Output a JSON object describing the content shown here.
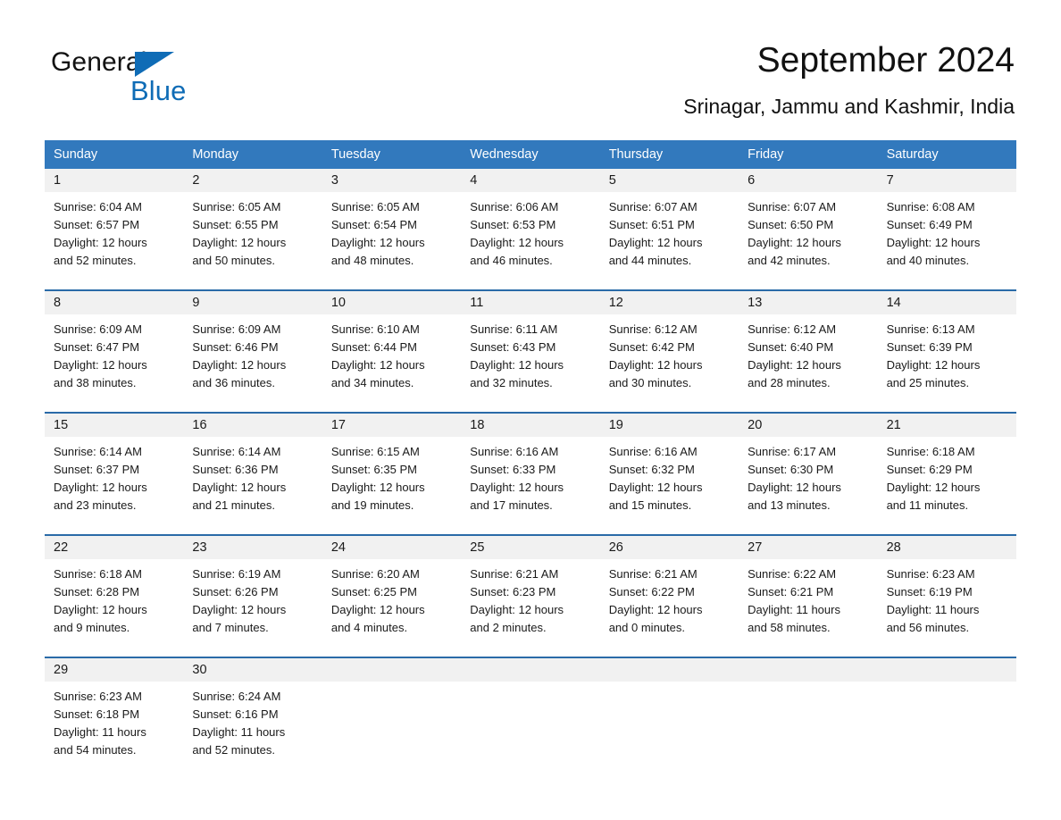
{
  "brand": {
    "line1": "General",
    "line2": "Blue",
    "triangle_color": "#0f6cb6"
  },
  "header": {
    "title": "September 2024",
    "subtitle": "Srinagar, Jammu and Kashmir, India"
  },
  "colors": {
    "header_blue": "#3279bd",
    "row_rule_blue": "#2a6ba8",
    "day_band_gray": "#f1f1f1",
    "text": "#1a1a1a"
  },
  "weekdays": [
    "Sunday",
    "Monday",
    "Tuesday",
    "Wednesday",
    "Thursday",
    "Friday",
    "Saturday"
  ],
  "weeks": [
    [
      {
        "day": "1",
        "sunrise": "Sunrise: 6:04 AM",
        "sunset": "Sunset: 6:57 PM",
        "daylight_line1": "Daylight: 12 hours",
        "daylight_line2": "and 52 minutes."
      },
      {
        "day": "2",
        "sunrise": "Sunrise: 6:05 AM",
        "sunset": "Sunset: 6:55 PM",
        "daylight_line1": "Daylight: 12 hours",
        "daylight_line2": "and 50 minutes."
      },
      {
        "day": "3",
        "sunrise": "Sunrise: 6:05 AM",
        "sunset": "Sunset: 6:54 PM",
        "daylight_line1": "Daylight: 12 hours",
        "daylight_line2": "and 48 minutes."
      },
      {
        "day": "4",
        "sunrise": "Sunrise: 6:06 AM",
        "sunset": "Sunset: 6:53 PM",
        "daylight_line1": "Daylight: 12 hours",
        "daylight_line2": "and 46 minutes."
      },
      {
        "day": "5",
        "sunrise": "Sunrise: 6:07 AM",
        "sunset": "Sunset: 6:51 PM",
        "daylight_line1": "Daylight: 12 hours",
        "daylight_line2": "and 44 minutes."
      },
      {
        "day": "6",
        "sunrise": "Sunrise: 6:07 AM",
        "sunset": "Sunset: 6:50 PM",
        "daylight_line1": "Daylight: 12 hours",
        "daylight_line2": "and 42 minutes."
      },
      {
        "day": "7",
        "sunrise": "Sunrise: 6:08 AM",
        "sunset": "Sunset: 6:49 PM",
        "daylight_line1": "Daylight: 12 hours",
        "daylight_line2": "and 40 minutes."
      }
    ],
    [
      {
        "day": "8",
        "sunrise": "Sunrise: 6:09 AM",
        "sunset": "Sunset: 6:47 PM",
        "daylight_line1": "Daylight: 12 hours",
        "daylight_line2": "and 38 minutes."
      },
      {
        "day": "9",
        "sunrise": "Sunrise: 6:09 AM",
        "sunset": "Sunset: 6:46 PM",
        "daylight_line1": "Daylight: 12 hours",
        "daylight_line2": "and 36 minutes."
      },
      {
        "day": "10",
        "sunrise": "Sunrise: 6:10 AM",
        "sunset": "Sunset: 6:44 PM",
        "daylight_line1": "Daylight: 12 hours",
        "daylight_line2": "and 34 minutes."
      },
      {
        "day": "11",
        "sunrise": "Sunrise: 6:11 AM",
        "sunset": "Sunset: 6:43 PM",
        "daylight_line1": "Daylight: 12 hours",
        "daylight_line2": "and 32 minutes."
      },
      {
        "day": "12",
        "sunrise": "Sunrise: 6:12 AM",
        "sunset": "Sunset: 6:42 PM",
        "daylight_line1": "Daylight: 12 hours",
        "daylight_line2": "and 30 minutes."
      },
      {
        "day": "13",
        "sunrise": "Sunrise: 6:12 AM",
        "sunset": "Sunset: 6:40 PM",
        "daylight_line1": "Daylight: 12 hours",
        "daylight_line2": "and 28 minutes."
      },
      {
        "day": "14",
        "sunrise": "Sunrise: 6:13 AM",
        "sunset": "Sunset: 6:39 PM",
        "daylight_line1": "Daylight: 12 hours",
        "daylight_line2": "and 25 minutes."
      }
    ],
    [
      {
        "day": "15",
        "sunrise": "Sunrise: 6:14 AM",
        "sunset": "Sunset: 6:37 PM",
        "daylight_line1": "Daylight: 12 hours",
        "daylight_line2": "and 23 minutes."
      },
      {
        "day": "16",
        "sunrise": "Sunrise: 6:14 AM",
        "sunset": "Sunset: 6:36 PM",
        "daylight_line1": "Daylight: 12 hours",
        "daylight_line2": "and 21 minutes."
      },
      {
        "day": "17",
        "sunrise": "Sunrise: 6:15 AM",
        "sunset": "Sunset: 6:35 PM",
        "daylight_line1": "Daylight: 12 hours",
        "daylight_line2": "and 19 minutes."
      },
      {
        "day": "18",
        "sunrise": "Sunrise: 6:16 AM",
        "sunset": "Sunset: 6:33 PM",
        "daylight_line1": "Daylight: 12 hours",
        "daylight_line2": "and 17 minutes."
      },
      {
        "day": "19",
        "sunrise": "Sunrise: 6:16 AM",
        "sunset": "Sunset: 6:32 PM",
        "daylight_line1": "Daylight: 12 hours",
        "daylight_line2": "and 15 minutes."
      },
      {
        "day": "20",
        "sunrise": "Sunrise: 6:17 AM",
        "sunset": "Sunset: 6:30 PM",
        "daylight_line1": "Daylight: 12 hours",
        "daylight_line2": "and 13 minutes."
      },
      {
        "day": "21",
        "sunrise": "Sunrise: 6:18 AM",
        "sunset": "Sunset: 6:29 PM",
        "daylight_line1": "Daylight: 12 hours",
        "daylight_line2": "and 11 minutes."
      }
    ],
    [
      {
        "day": "22",
        "sunrise": "Sunrise: 6:18 AM",
        "sunset": "Sunset: 6:28 PM",
        "daylight_line1": "Daylight: 12 hours",
        "daylight_line2": "and 9 minutes."
      },
      {
        "day": "23",
        "sunrise": "Sunrise: 6:19 AM",
        "sunset": "Sunset: 6:26 PM",
        "daylight_line1": "Daylight: 12 hours",
        "daylight_line2": "and 7 minutes."
      },
      {
        "day": "24",
        "sunrise": "Sunrise: 6:20 AM",
        "sunset": "Sunset: 6:25 PM",
        "daylight_line1": "Daylight: 12 hours",
        "daylight_line2": "and 4 minutes."
      },
      {
        "day": "25",
        "sunrise": "Sunrise: 6:21 AM",
        "sunset": "Sunset: 6:23 PM",
        "daylight_line1": "Daylight: 12 hours",
        "daylight_line2": "and 2 minutes."
      },
      {
        "day": "26",
        "sunrise": "Sunrise: 6:21 AM",
        "sunset": "Sunset: 6:22 PM",
        "daylight_line1": "Daylight: 12 hours",
        "daylight_line2": "and 0 minutes."
      },
      {
        "day": "27",
        "sunrise": "Sunrise: 6:22 AM",
        "sunset": "Sunset: 6:21 PM",
        "daylight_line1": "Daylight: 11 hours",
        "daylight_line2": "and 58 minutes."
      },
      {
        "day": "28",
        "sunrise": "Sunrise: 6:23 AM",
        "sunset": "Sunset: 6:19 PM",
        "daylight_line1": "Daylight: 11 hours",
        "daylight_line2": "and 56 minutes."
      }
    ],
    [
      {
        "day": "29",
        "sunrise": "Sunrise: 6:23 AM",
        "sunset": "Sunset: 6:18 PM",
        "daylight_line1": "Daylight: 11 hours",
        "daylight_line2": "and 54 minutes."
      },
      {
        "day": "30",
        "sunrise": "Sunrise: 6:24 AM",
        "sunset": "Sunset: 6:16 PM",
        "daylight_line1": "Daylight: 11 hours",
        "daylight_line2": "and 52 minutes."
      },
      {
        "day": "",
        "sunrise": "",
        "sunset": "",
        "daylight_line1": "",
        "daylight_line2": ""
      },
      {
        "day": "",
        "sunrise": "",
        "sunset": "",
        "daylight_line1": "",
        "daylight_line2": ""
      },
      {
        "day": "",
        "sunrise": "",
        "sunset": "",
        "daylight_line1": "",
        "daylight_line2": ""
      },
      {
        "day": "",
        "sunrise": "",
        "sunset": "",
        "daylight_line1": "",
        "daylight_line2": ""
      },
      {
        "day": "",
        "sunrise": "",
        "sunset": "",
        "daylight_line1": "",
        "daylight_line2": ""
      }
    ]
  ]
}
